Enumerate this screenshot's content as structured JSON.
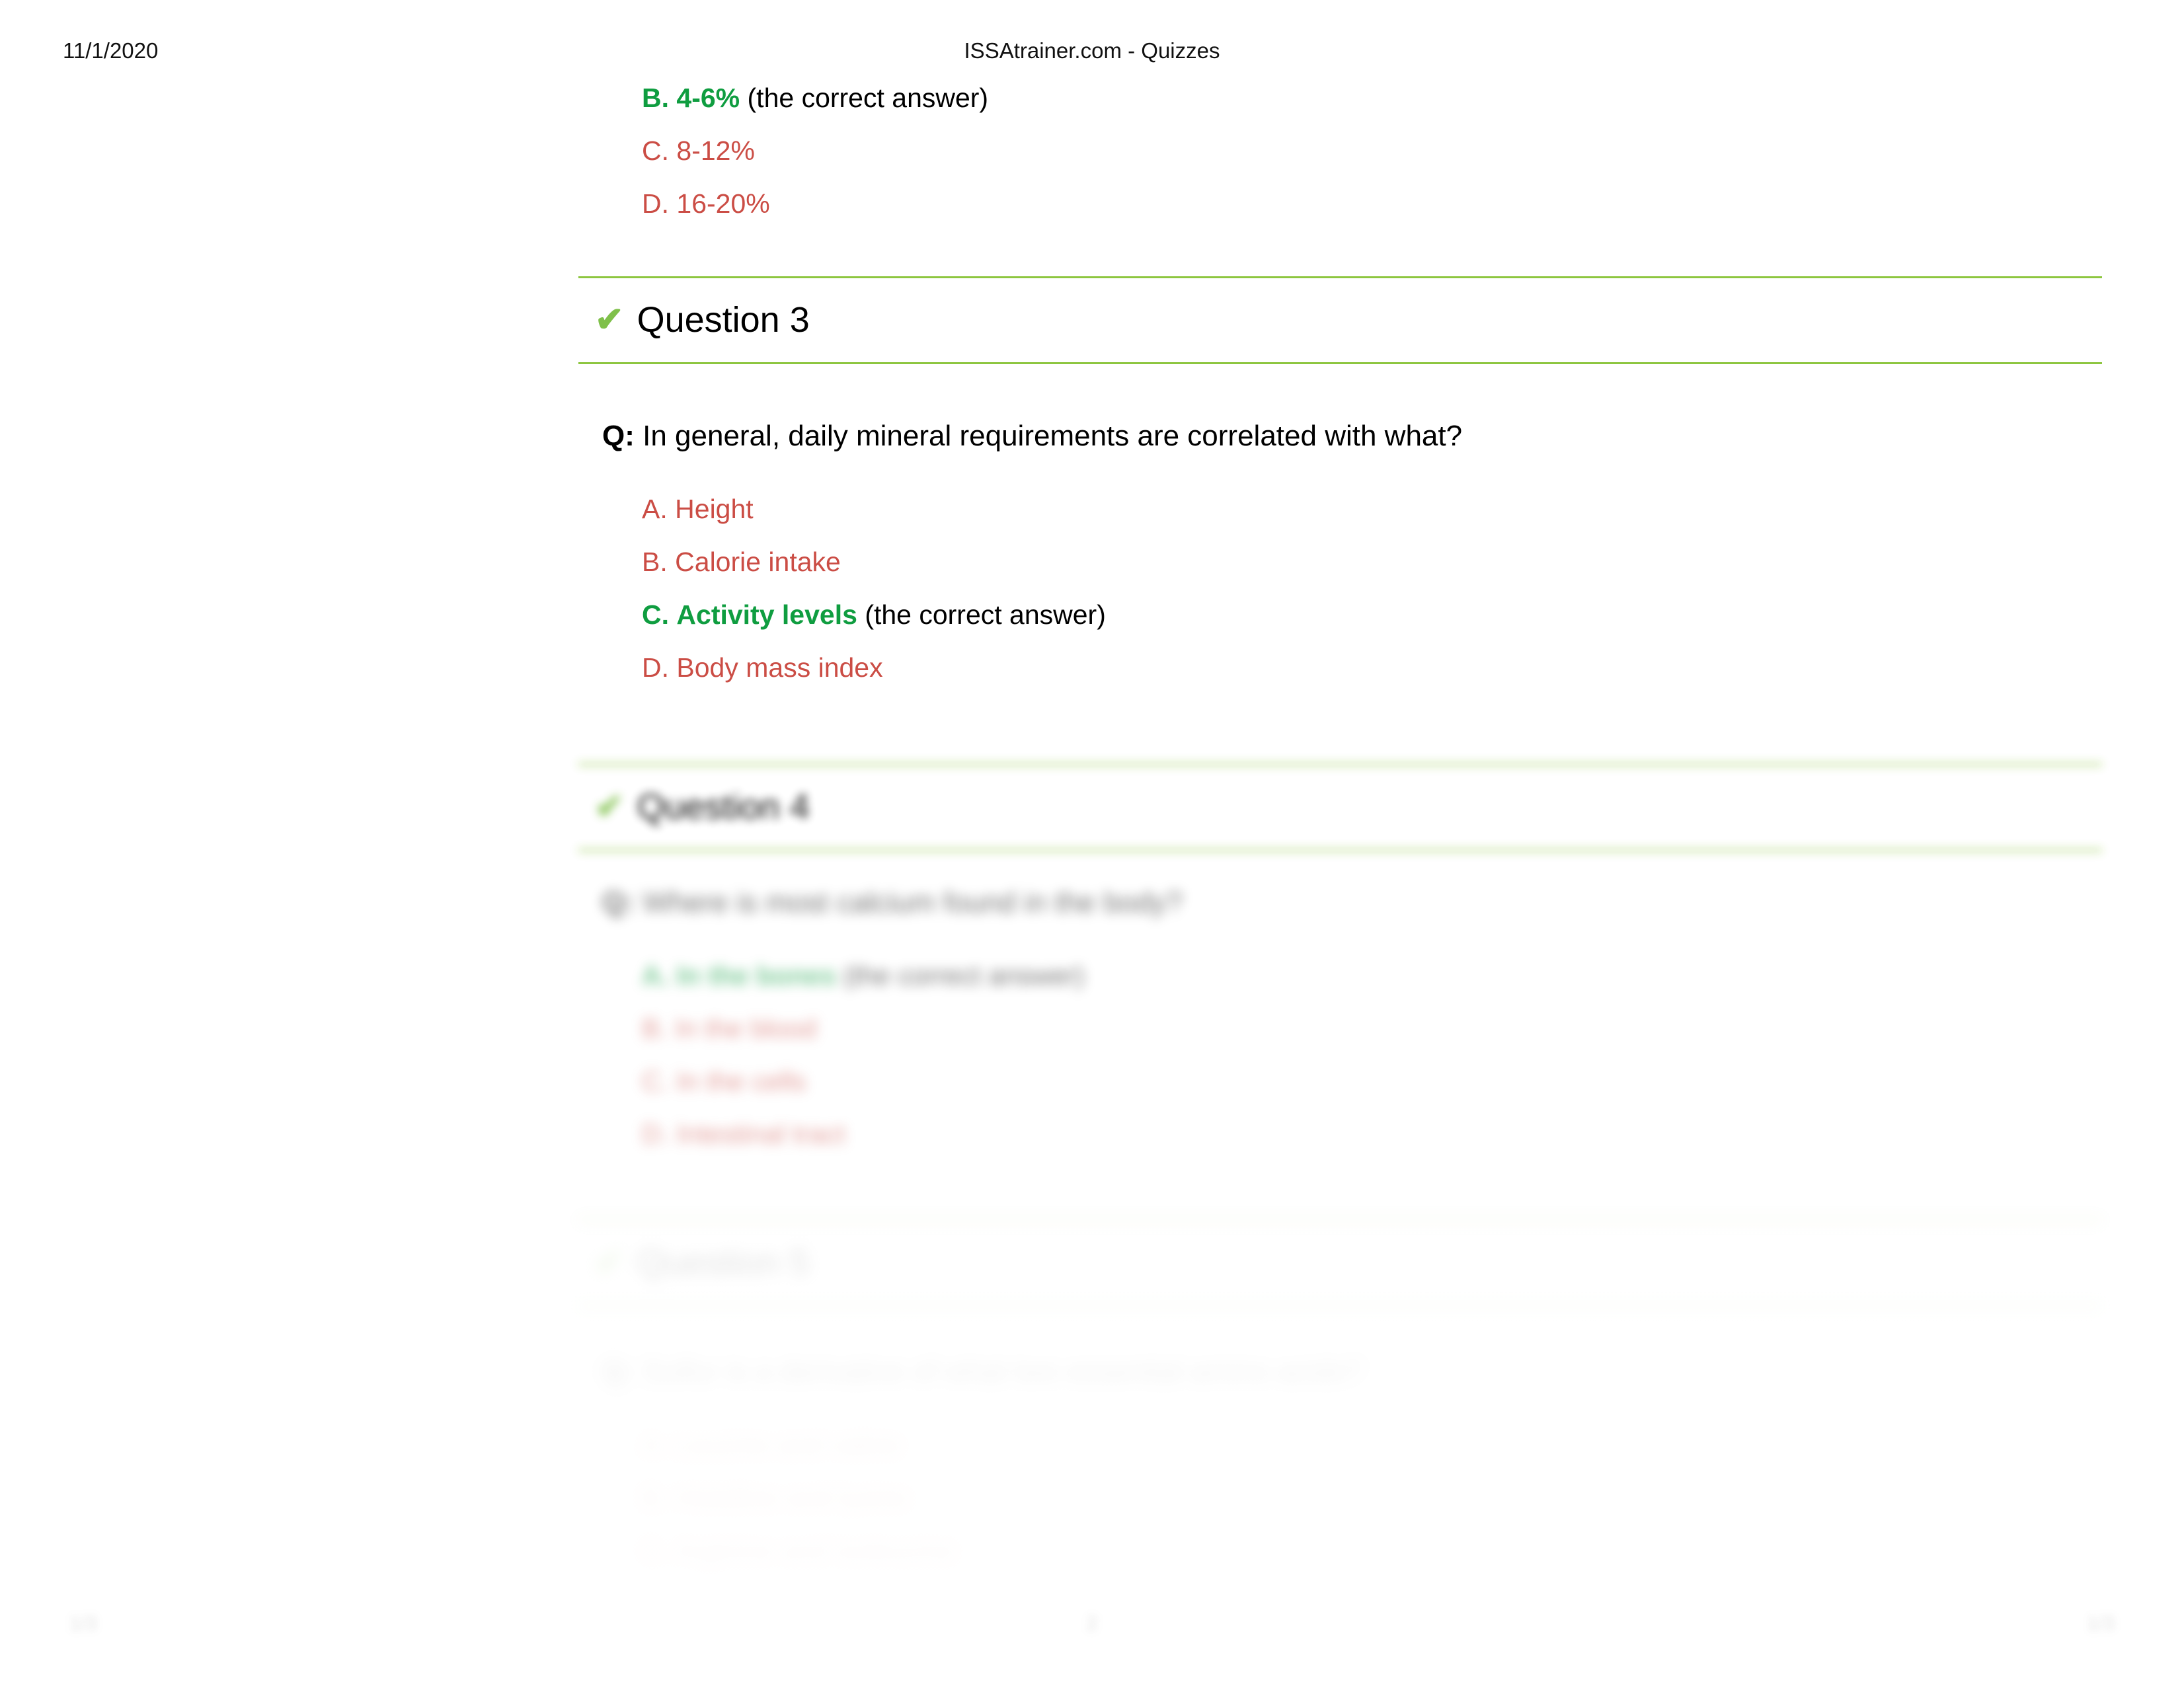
{
  "print_header": {
    "date": "11/1/2020",
    "title": "ISSAtrainer.com - Quizzes"
  },
  "print_footer": {
    "left": "1/3",
    "center": "2",
    "right": "1/3"
  },
  "icons": {
    "check": "✔",
    "question_mark": "Q:"
  },
  "colors": {
    "correct_green": "#0f9d40",
    "incorrect_red": "#cb4d45",
    "rule_green": "#8dc63f",
    "check_green": "#7fc04a",
    "text_black": "#000000"
  },
  "question_2_tail": {
    "options": [
      {
        "letter": "B.",
        "text": "4-6%",
        "note": "(the correct answer)",
        "state": "correct"
      },
      {
        "letter": "C.",
        "text": "8-12%",
        "note": "",
        "state": "incorrect"
      },
      {
        "letter": "D.",
        "text": "16-20%",
        "note": "",
        "state": "incorrect"
      }
    ]
  },
  "questions": [
    {
      "title": "Question 3",
      "prompt": "In general, daily mineral requirements are correlated with what?",
      "blurred": false,
      "options": [
        {
          "letter": "A.",
          "text": "Height",
          "note": "",
          "state": "incorrect"
        },
        {
          "letter": "B.",
          "text": "Calorie intake",
          "note": "",
          "state": "incorrect"
        },
        {
          "letter": "C.",
          "text": "Activity levels",
          "note": "(the correct answer)",
          "state": "correct"
        },
        {
          "letter": "D.",
          "text": "Body mass index",
          "note": "",
          "state": "incorrect"
        }
      ]
    },
    {
      "title": "Question 4",
      "prompt": "Where is most calcium found in the body?",
      "blurred": true,
      "options": [
        {
          "letter": "A.",
          "text": "In the bones",
          "note": "(the correct answer)",
          "state": "correct"
        },
        {
          "letter": "B.",
          "text": "In the blood",
          "note": "",
          "state": "incorrect"
        },
        {
          "letter": "C.",
          "text": "In the cells",
          "note": "",
          "state": "incorrect"
        },
        {
          "letter": "D.",
          "text": "Intestinal tract",
          "note": "",
          "state": "incorrect"
        }
      ]
    },
    {
      "title": "Question 5",
      "prompt": "Sulfur is a derivative of what two essential amino acids?",
      "blurred": true,
      "options": [
        {
          "letter": "A.",
          "text": "Leucine and valine",
          "note": "",
          "state": "incorrect"
        },
        {
          "letter": "B.",
          "text": "Histidine and lysine",
          "note": "",
          "state": "incorrect"
        },
        {
          "letter": "C.",
          "text": "Arginine and isoleucine",
          "note": "",
          "state": "incorrect"
        }
      ]
    }
  ]
}
